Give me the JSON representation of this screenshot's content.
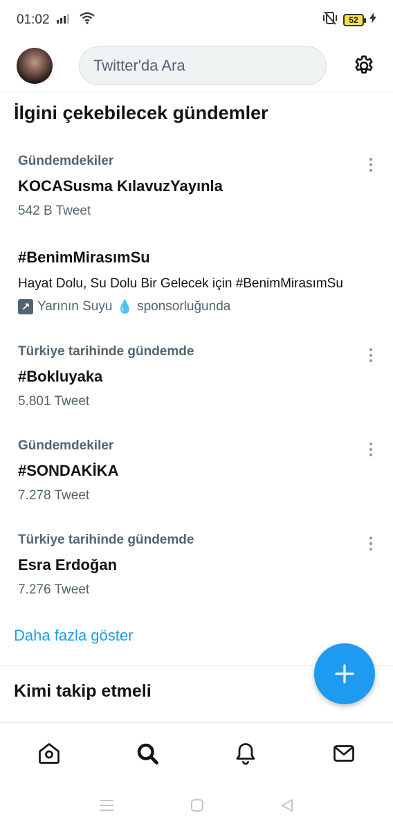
{
  "status_bar": {
    "time": "01:02",
    "battery": "52"
  },
  "header": {
    "search_placeholder": "Twitter'da Ara"
  },
  "section_title": "İlgini çekebilecek gündemler",
  "trends": [
    {
      "meta": "Gündemdekiler",
      "name": "KOCASusma KılavuzYayınla",
      "count": "542 B Tweet"
    },
    {
      "name": "#BenimMirasımSu",
      "description": "Hayat Dolu, Su Dolu Bir Gelecek için #BenimMirasımSu",
      "promo_brand": "Yarının Suyu",
      "promo_suffix": "sponsorluğunda"
    },
    {
      "meta": "Türkiye tarihinde gündemde",
      "name": "#Bokluyaka",
      "count": "5.801 Tweet"
    },
    {
      "meta": "Gündemdekiler",
      "name": "#SONDAKİKA",
      "count": "7.278 Tweet"
    },
    {
      "meta": "Türkiye tarihinde gündemde",
      "name": "Esra Erdoğan",
      "count": "7.276 Tweet"
    }
  ],
  "show_more": "Daha fazla göster",
  "who_to_follow": "Kimi takip etmeli",
  "colors": {
    "accent": "#1d9bf0",
    "secondary_text": "#536471"
  },
  "icons": {
    "header": [
      "avatar",
      "settings-gear-icon"
    ],
    "tabs": [
      "home-icon",
      "search-icon",
      "notifications-bell-icon",
      "messages-envelope-icon"
    ],
    "system_nav": [
      "menu-icon",
      "home-square-icon",
      "back-triangle-icon"
    ]
  }
}
